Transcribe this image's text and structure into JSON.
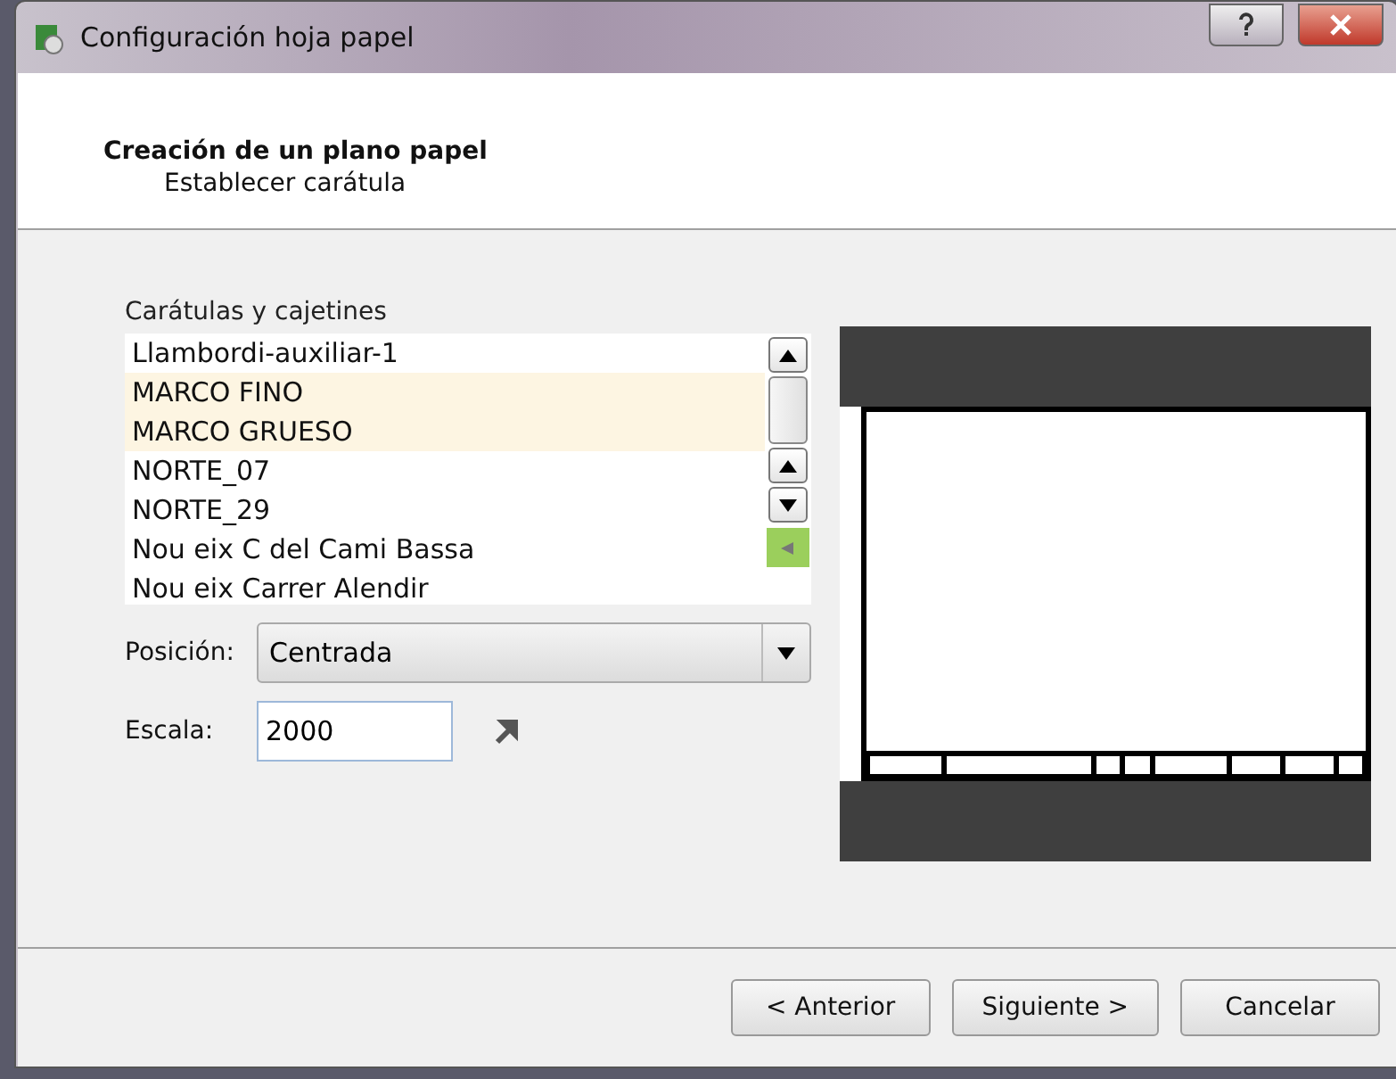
{
  "window": {
    "title": "Configuración hoja papel"
  },
  "header": {
    "title": "Creación de un plano papel",
    "subtitle": "Establecer carátula"
  },
  "list": {
    "label": "Carátulas y cajetines",
    "items": [
      {
        "label": "Llambordi-auxiliar-1",
        "selected": false
      },
      {
        "label": "MARCO FINO",
        "selected": true
      },
      {
        "label": "MARCO GRUESO",
        "selected": true
      },
      {
        "label": "NORTE_07",
        "selected": false
      },
      {
        "label": "NORTE_29",
        "selected": false
      },
      {
        "label": "Nou eix C del Cami Bassa",
        "selected": false
      },
      {
        "label": "Nou eix Carrer Alendir",
        "selected": false
      }
    ]
  },
  "position": {
    "label": "Posición:",
    "value": "Centrada"
  },
  "scale": {
    "label": "Escala:",
    "value": "2000"
  },
  "buttons": [
    "< Anterior",
    "Siguiente >",
    "Cancelar"
  ]
}
